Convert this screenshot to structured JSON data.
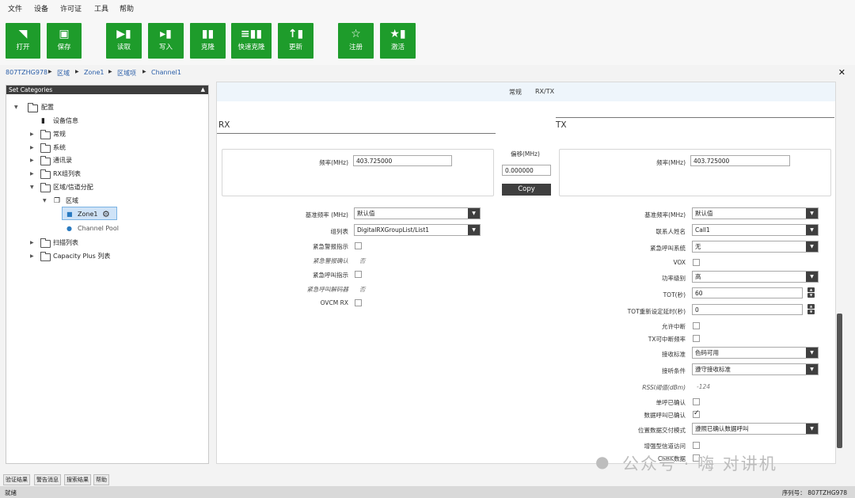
{
  "menu": {
    "items": [
      "文件",
      "设备",
      "许可证",
      "工具",
      "帮助"
    ]
  },
  "toolbar": {
    "buttons": [
      {
        "label": "打开",
        "icon": "folder-open-icon"
      },
      {
        "label": "保存",
        "icon": "floppy-disk-icon"
      },
      {
        "label": "读取",
        "icon": "radio-read-icon"
      },
      {
        "label": "写入",
        "icon": "radio-write-icon"
      },
      {
        "label": "克隆",
        "icon": "radio-clone-icon"
      },
      {
        "label": "快速克隆",
        "icon": "radio-quick-clone-icon"
      },
      {
        "label": "更新",
        "icon": "radio-update-icon"
      },
      {
        "label": "注册",
        "icon": "star-icon"
      },
      {
        "label": "激活",
        "icon": "radio-activate-icon"
      }
    ],
    "accent": "#1e9c2b"
  },
  "breadcrumb": [
    "807TZHG978",
    "区域",
    "Zone1",
    "区域项",
    "Channel1"
  ],
  "left_panel": {
    "title": "Set Categories",
    "tree": {
      "root": "配置",
      "device_info": "设备信息",
      "general": "常规",
      "system": "系统",
      "contacts": "通讯录",
      "rx_group": "RX组列表",
      "zone_channel": "区域/信道分配",
      "zone": "区域",
      "zone1": "Zone1",
      "channel_pool": "Channel Pool",
      "scan_list": "扫描列表",
      "capacity_plus": "Capacity Plus 列表"
    }
  },
  "main": {
    "tabs": [
      "常规",
      "RX/TX"
    ],
    "rx": {
      "title": "RX",
      "freq_label": "频率(MHz)",
      "freq_value": "403.725000",
      "ref_freq_label": "基准频率 (MHz)",
      "ref_freq_value": "默认值",
      "group_list_label": "组列表",
      "group_list_value": "DigitalRXGroupList/List1",
      "emergency_alarm_label": "紧急警报指示",
      "emergency_alarm_ack_label": "紧急警报确认",
      "emergency_alarm_ack_value": "否",
      "emergency_call_label": "紧急呼叫指示",
      "emergency_call_decode_label": "紧急呼叫解码器",
      "emergency_call_decode_value": "否",
      "ovcm_label": "OVCM RX"
    },
    "offset": {
      "label": "偏移(MHz)",
      "value": "0.000000",
      "copy_label": "Copy"
    },
    "tx": {
      "title": "TX",
      "freq_label": "频率(MHz)",
      "freq_value": "403.725000",
      "ref_freq_label": "基准频率(MHz)",
      "ref_freq_value": "默认值",
      "contact_label": "联系人姓名",
      "contact_value": "Call1",
      "emergency_system_label": "紧急呼叫系统",
      "emergency_system_value": "无",
      "vox_label": "VOX",
      "power_label": "功率级别",
      "power_value": "高",
      "tot_label": "TOT(秒)",
      "tot_value": "60",
      "tot_rekey_label": "TOT重新设定延时(秒)",
      "tot_rekey_value": "0",
      "allow_interrupt_label": "允许中断",
      "tx_interrupt_label": "TX可中断频率",
      "rx_criteria_label": "接收标准",
      "rx_criteria_value": "色码可用",
      "tx_condition_label": "接听条件",
      "tx_condition_value": "遵守接收标准",
      "rssi_label": "RSSI阈值(dBm)",
      "rssi_value": "-124",
      "private_call_ack_label": "单呼已确认",
      "data_call_ack_label": "数据呼叫已确认",
      "data_call_ack_checked": true,
      "location_mode_label": "位置数据交付模式",
      "location_mode_value": "遵照已确认数据呼叫",
      "enhanced_channel_label": "增强型信道访问",
      "csbk_label": "CSBK数据"
    }
  },
  "bottom_tabs": [
    "验证结果",
    "警告消息",
    "搜索结果",
    "帮助"
  ],
  "status": {
    "text": "就绪",
    "serial": "序列号： 807TZHG978"
  },
  "watermark": {
    "text": "公众号 · 嗨 对讲机",
    "icon": "wechat-icon"
  }
}
